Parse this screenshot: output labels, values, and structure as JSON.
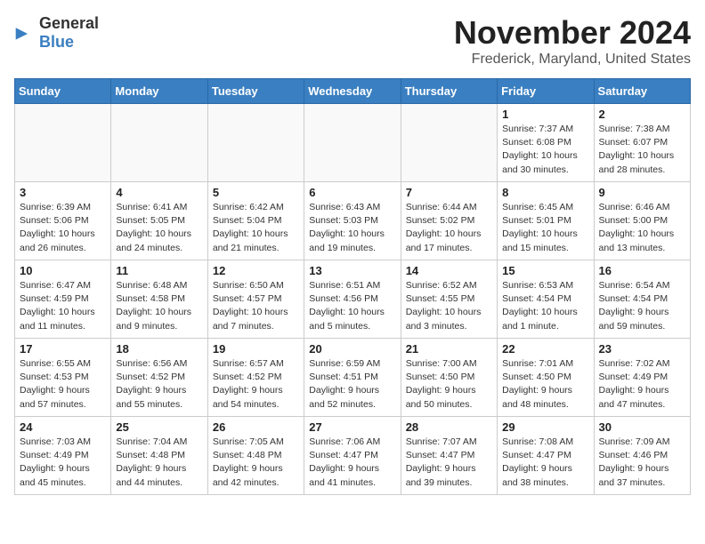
{
  "header": {
    "logo_general": "General",
    "logo_blue": "Blue",
    "month": "November 2024",
    "location": "Frederick, Maryland, United States"
  },
  "days_of_week": [
    "Sunday",
    "Monday",
    "Tuesday",
    "Wednesday",
    "Thursday",
    "Friday",
    "Saturday"
  ],
  "weeks": [
    [
      {
        "day": "",
        "info": "",
        "empty": true
      },
      {
        "day": "",
        "info": "",
        "empty": true
      },
      {
        "day": "",
        "info": "",
        "empty": true
      },
      {
        "day": "",
        "info": "",
        "empty": true
      },
      {
        "day": "",
        "info": "",
        "empty": true
      },
      {
        "day": "1",
        "info": "Sunrise: 7:37 AM\nSunset: 6:08 PM\nDaylight: 10 hours and 30 minutes."
      },
      {
        "day": "2",
        "info": "Sunrise: 7:38 AM\nSunset: 6:07 PM\nDaylight: 10 hours and 28 minutes."
      }
    ],
    [
      {
        "day": "3",
        "info": "Sunrise: 6:39 AM\nSunset: 5:06 PM\nDaylight: 10 hours and 26 minutes."
      },
      {
        "day": "4",
        "info": "Sunrise: 6:41 AM\nSunset: 5:05 PM\nDaylight: 10 hours and 24 minutes."
      },
      {
        "day": "5",
        "info": "Sunrise: 6:42 AM\nSunset: 5:04 PM\nDaylight: 10 hours and 21 minutes."
      },
      {
        "day": "6",
        "info": "Sunrise: 6:43 AM\nSunset: 5:03 PM\nDaylight: 10 hours and 19 minutes."
      },
      {
        "day": "7",
        "info": "Sunrise: 6:44 AM\nSunset: 5:02 PM\nDaylight: 10 hours and 17 minutes."
      },
      {
        "day": "8",
        "info": "Sunrise: 6:45 AM\nSunset: 5:01 PM\nDaylight: 10 hours and 15 minutes."
      },
      {
        "day": "9",
        "info": "Sunrise: 6:46 AM\nSunset: 5:00 PM\nDaylight: 10 hours and 13 minutes."
      }
    ],
    [
      {
        "day": "10",
        "info": "Sunrise: 6:47 AM\nSunset: 4:59 PM\nDaylight: 10 hours and 11 minutes."
      },
      {
        "day": "11",
        "info": "Sunrise: 6:48 AM\nSunset: 4:58 PM\nDaylight: 10 hours and 9 minutes."
      },
      {
        "day": "12",
        "info": "Sunrise: 6:50 AM\nSunset: 4:57 PM\nDaylight: 10 hours and 7 minutes."
      },
      {
        "day": "13",
        "info": "Sunrise: 6:51 AM\nSunset: 4:56 PM\nDaylight: 10 hours and 5 minutes."
      },
      {
        "day": "14",
        "info": "Sunrise: 6:52 AM\nSunset: 4:55 PM\nDaylight: 10 hours and 3 minutes."
      },
      {
        "day": "15",
        "info": "Sunrise: 6:53 AM\nSunset: 4:54 PM\nDaylight: 10 hours and 1 minute."
      },
      {
        "day": "16",
        "info": "Sunrise: 6:54 AM\nSunset: 4:54 PM\nDaylight: 9 hours and 59 minutes."
      }
    ],
    [
      {
        "day": "17",
        "info": "Sunrise: 6:55 AM\nSunset: 4:53 PM\nDaylight: 9 hours and 57 minutes."
      },
      {
        "day": "18",
        "info": "Sunrise: 6:56 AM\nSunset: 4:52 PM\nDaylight: 9 hours and 55 minutes."
      },
      {
        "day": "19",
        "info": "Sunrise: 6:57 AM\nSunset: 4:52 PM\nDaylight: 9 hours and 54 minutes."
      },
      {
        "day": "20",
        "info": "Sunrise: 6:59 AM\nSunset: 4:51 PM\nDaylight: 9 hours and 52 minutes."
      },
      {
        "day": "21",
        "info": "Sunrise: 7:00 AM\nSunset: 4:50 PM\nDaylight: 9 hours and 50 minutes."
      },
      {
        "day": "22",
        "info": "Sunrise: 7:01 AM\nSunset: 4:50 PM\nDaylight: 9 hours and 48 minutes."
      },
      {
        "day": "23",
        "info": "Sunrise: 7:02 AM\nSunset: 4:49 PM\nDaylight: 9 hours and 47 minutes."
      }
    ],
    [
      {
        "day": "24",
        "info": "Sunrise: 7:03 AM\nSunset: 4:49 PM\nDaylight: 9 hours and 45 minutes."
      },
      {
        "day": "25",
        "info": "Sunrise: 7:04 AM\nSunset: 4:48 PM\nDaylight: 9 hours and 44 minutes."
      },
      {
        "day": "26",
        "info": "Sunrise: 7:05 AM\nSunset: 4:48 PM\nDaylight: 9 hours and 42 minutes."
      },
      {
        "day": "27",
        "info": "Sunrise: 7:06 AM\nSunset: 4:47 PM\nDaylight: 9 hours and 41 minutes."
      },
      {
        "day": "28",
        "info": "Sunrise: 7:07 AM\nSunset: 4:47 PM\nDaylight: 9 hours and 39 minutes."
      },
      {
        "day": "29",
        "info": "Sunrise: 7:08 AM\nSunset: 4:47 PM\nDaylight: 9 hours and 38 minutes."
      },
      {
        "day": "30",
        "info": "Sunrise: 7:09 AM\nSunset: 4:46 PM\nDaylight: 9 hours and 37 minutes."
      }
    ]
  ]
}
